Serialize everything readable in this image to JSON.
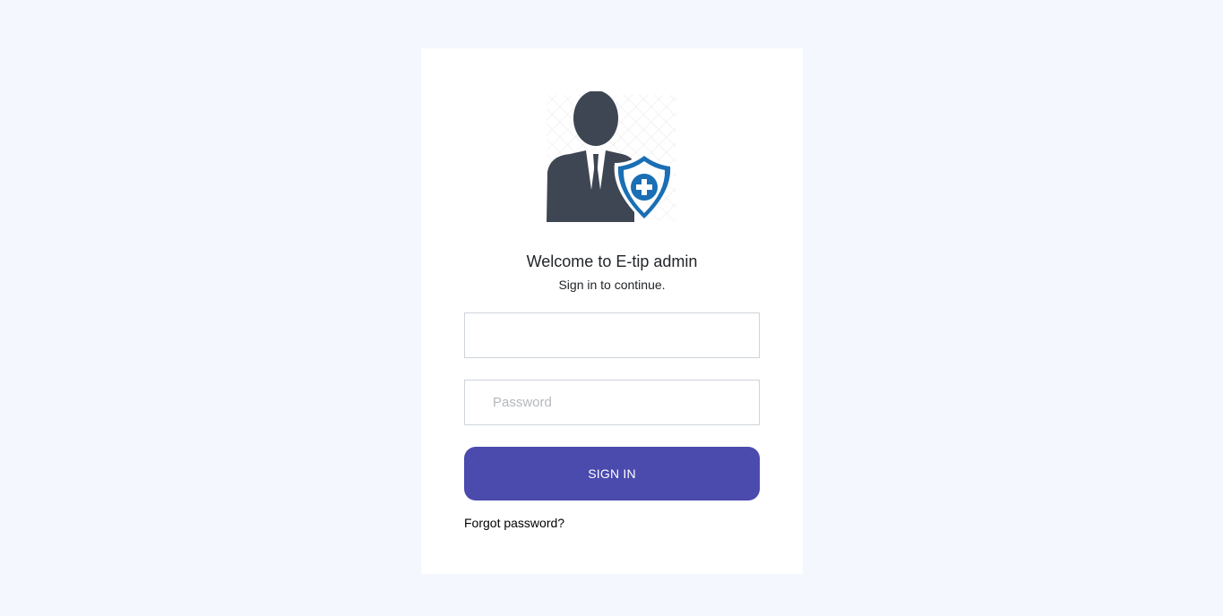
{
  "login": {
    "welcome": "Welcome to E-tip admin",
    "subtitle": "Sign in to continue.",
    "username_value": "",
    "password_placeholder": "Password",
    "signin_label": "SIGN IN",
    "forgot_label": "Forgot password?"
  },
  "logo": {
    "icon": "admin-user-shield-icon",
    "person_color": "#3e4553",
    "shield_color": "#1a6fb5"
  },
  "colors": {
    "page_background": "#f4f7fe",
    "button": "#4b4aad"
  }
}
